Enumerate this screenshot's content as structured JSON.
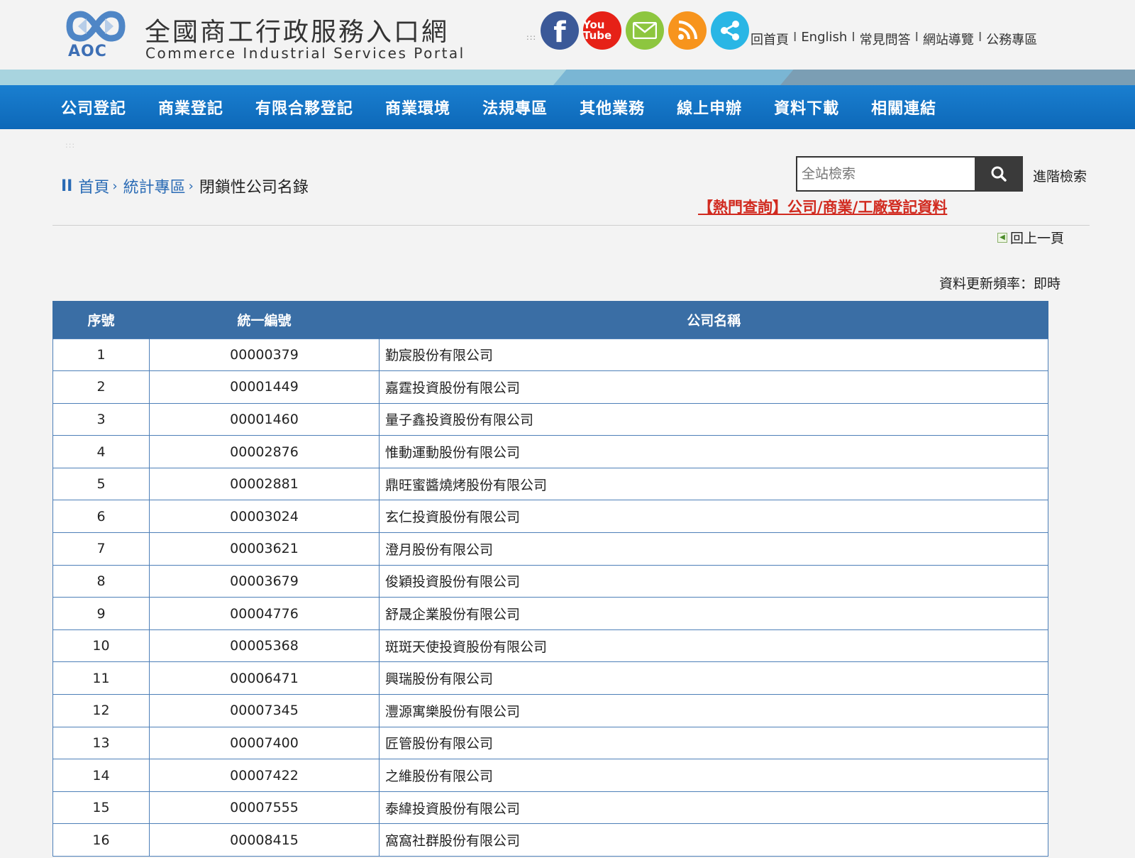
{
  "header": {
    "logo_text": "AOC",
    "title_zh": "全國商工行政服務入口網",
    "title_en": "Commerce Industrial Services Portal",
    "access_key": ":::",
    "social": [
      {
        "name": "facebook-icon",
        "glyph": "f",
        "color": "#3b5998"
      },
      {
        "name": "youtube-icon",
        "glyph": "You Tube",
        "color": "#e62117"
      },
      {
        "name": "email-icon",
        "glyph": "✉",
        "color": "#8dc63f"
      },
      {
        "name": "rss-icon",
        "glyph": "rss",
        "color": "#f7941d"
      },
      {
        "name": "share-icon",
        "glyph": "share",
        "color": "#29b6e5"
      }
    ],
    "top_links": [
      "回首頁",
      "English",
      "常見問答",
      "網站導覽",
      "公務專區"
    ],
    "top_links_sep": "I"
  },
  "nav": {
    "items": [
      "公司登記",
      "商業登記",
      "有限合夥登記",
      "商業環境",
      "法規專區",
      "其他業務",
      "線上申辦",
      "資料下載",
      "相關連結"
    ],
    "access_key": ":::"
  },
  "breadcrumb": {
    "mark": "II",
    "links": [
      "首頁",
      "統計專區"
    ],
    "chevron": "›",
    "current": "閉鎖性公司名錄"
  },
  "search": {
    "placeholder": "全站檢索",
    "advanced": "進階檢索",
    "hot_link": "【熱門查詢】公司/商業/工廠登記資料"
  },
  "back_link": "回上一頁",
  "update_freq": "資料更新頻率：即時",
  "table": {
    "headers": [
      "序號",
      "統一編號",
      "公司名稱"
    ],
    "rows": [
      [
        "1",
        "00000379",
        "勤宸股份有限公司"
      ],
      [
        "2",
        "00001449",
        "嘉霆投資股份有限公司"
      ],
      [
        "3",
        "00001460",
        "量子鑫投資股份有限公司"
      ],
      [
        "4",
        "00002876",
        "惟動運動股份有限公司"
      ],
      [
        "5",
        "00002881",
        "鼎旺蜜醬燒烤股份有限公司"
      ],
      [
        "6",
        "00003024",
        "玄仁投資股份有限公司"
      ],
      [
        "7",
        "00003621",
        "澄月股份有限公司"
      ],
      [
        "8",
        "00003679",
        "俊穎投資股份有限公司"
      ],
      [
        "9",
        "00004776",
        "舒晟企業股份有限公司"
      ],
      [
        "10",
        "00005368",
        "斑斑天使投資股份有限公司"
      ],
      [
        "11",
        "00006471",
        "興瑞股份有限公司"
      ],
      [
        "12",
        "00007345",
        "灃源寓樂股份有限公司"
      ],
      [
        "13",
        "00007400",
        "匠管股份有限公司"
      ],
      [
        "14",
        "00007422",
        "之維股份有限公司"
      ],
      [
        "15",
        "00007555",
        "泰緯投資股份有限公司"
      ],
      [
        "16",
        "00008415",
        "窩窩社群股份有限公司"
      ]
    ]
  }
}
